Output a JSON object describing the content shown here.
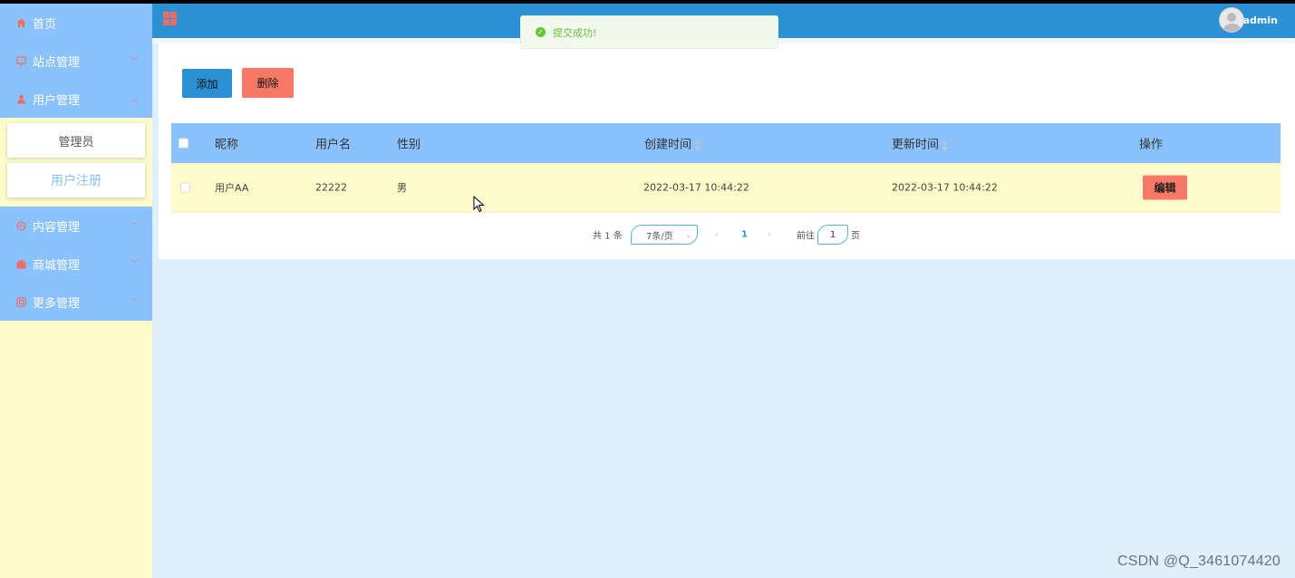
{
  "header": {
    "username": "admin"
  },
  "sidebar": {
    "items": [
      {
        "label": "首页",
        "icon": "home-icon",
        "color": "#f06b63"
      },
      {
        "label": "站点管理",
        "icon": "site-icon",
        "color": "#f06b63"
      },
      {
        "label": "用户管理",
        "icon": "user-icon",
        "color": "#f06b63"
      },
      {
        "label": "内容管理",
        "icon": "content-icon",
        "color": "#f06b63"
      },
      {
        "label": "商城管理",
        "icon": "shop-icon",
        "color": "#f06b63"
      },
      {
        "label": "更多管理",
        "icon": "more-icon",
        "color": "#f06b63"
      }
    ],
    "user_submenu": [
      {
        "label": "管理员"
      },
      {
        "label": "用户注册"
      }
    ]
  },
  "toast": {
    "message": "提交成功!"
  },
  "toolbar": {
    "add_label": "添加",
    "delete_label": "删除"
  },
  "table": {
    "columns": {
      "nickname": "昵称",
      "username": "用户名",
      "gender": "性别",
      "created": "创建时间",
      "updated": "更新时间",
      "actions": "操作"
    },
    "rows": [
      {
        "nickname": "用户AA",
        "username": "22222",
        "gender": "男",
        "created": "2022-03-17 10:44:22",
        "updated": "2022-03-17 10:44:22",
        "edit_label": "编辑"
      }
    ]
  },
  "pagination": {
    "total_text": "共 1 条",
    "page_size": "7条/页",
    "current_page": "1",
    "goto_prefix": "前往",
    "goto_value": "1",
    "goto_suffix": "页"
  },
  "watermark": "CSDN @Q_3461074420",
  "colors": {
    "header": "#2b90d4",
    "sidebar_item": "#8ac2fd",
    "sidebar_bg": "#fefbca",
    "danger": "#f87868",
    "success": "#67c23a"
  }
}
